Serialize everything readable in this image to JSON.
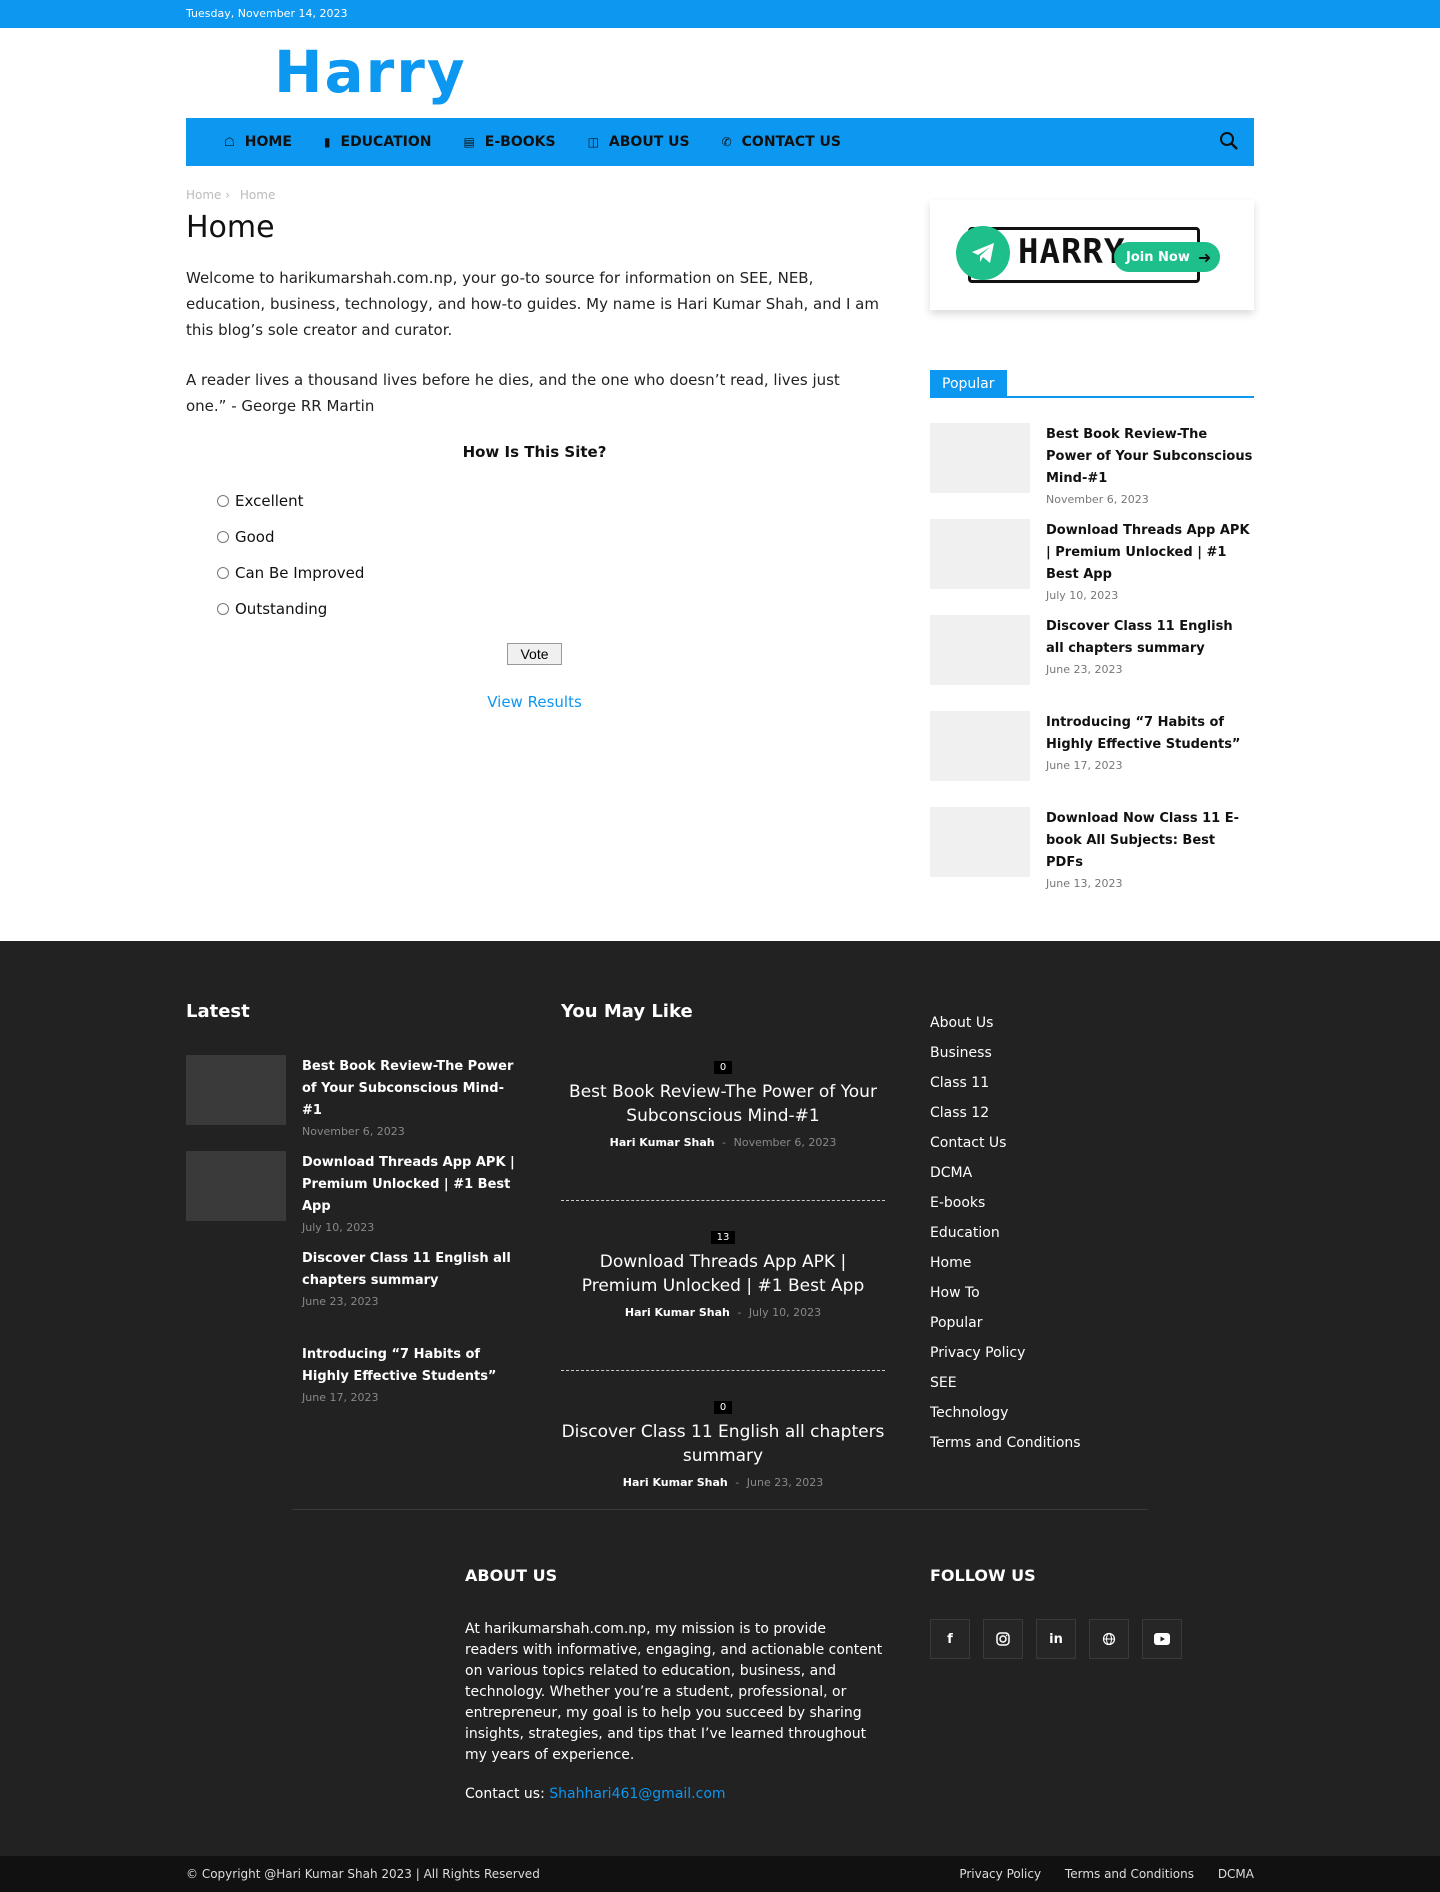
{
  "topbar": {
    "date": "Tuesday, November 14, 2023"
  },
  "header": {
    "logo": "Harry"
  },
  "nav": {
    "items": [
      {
        "label": "HOME",
        "icon": "home-icon"
      },
      {
        "label": "EDUCATION",
        "icon": "book-icon"
      },
      {
        "label": "E-BOOKS",
        "icon": "notebook-icon"
      },
      {
        "label": "ABOUT US",
        "icon": "id-card-icon"
      },
      {
        "label": "CONTACT US",
        "icon": "phone-icon"
      }
    ]
  },
  "breadcrumb": [
    "Home",
    "Home"
  ],
  "page": {
    "title": "Home",
    "intro": "Welcome to harikumarshah.com.np, your go-to source for information on SEE, NEB, education, business, technology, and how-to guides. My name is Hari Kumar Shah, and I am this blog’s sole creator and curator.",
    "quote": "A reader lives a thousand lives before he dies, and the one who doesn’t read, lives just one.” - George RR Martin"
  },
  "poll": {
    "question": "How Is This Site?",
    "options": [
      "Excellent",
      "Good",
      "Can Be Improved",
      "Outstanding"
    ],
    "vote_label": "Vote",
    "results_label": "View Results"
  },
  "promo": {
    "brand": "HARRY",
    "button": "Join Now"
  },
  "popular": {
    "tab": "Popular",
    "items": [
      {
        "title": "Best Book Review-The Power of Your Subconscious Mind-#1",
        "date": "November 6, 2023"
      },
      {
        "title": "Download Threads App APK | Premium Unlocked | #1 Best App",
        "date": "July 10, 2023"
      },
      {
        "title": "Discover Class 11 English all chapters summary",
        "date": "June 23, 2023"
      },
      {
        "title": "Introducing “7 Habits of Highly Effective Students”",
        "date": "June 17, 2023"
      },
      {
        "title": "Download Now Class 11 E-book All Subjects: Best PDFs",
        "date": "June 13, 2023"
      }
    ]
  },
  "footer": {
    "latest": {
      "heading": "Latest",
      "items": [
        {
          "title": "Best Book Review-The Power of Your Subconscious Mind-#1",
          "date": "November 6, 2023"
        },
        {
          "title": "Download Threads App APK | Premium Unlocked | #1 Best App",
          "date": "July 10, 2023"
        },
        {
          "title": "Discover Class 11 English all chapters summary",
          "date": "June 23, 2023"
        },
        {
          "title": "Introducing “7 Habits of Highly Effective Students”",
          "date": "June 17, 2023"
        }
      ]
    },
    "you_may_like": {
      "heading": "You May Like",
      "items": [
        {
          "count": "0",
          "title": "Best Book Review-The Power of Your Subconscious Mind-#1",
          "author": "Hari Kumar Shah",
          "sep": "-",
          "date": "November 6, 2023"
        },
        {
          "count": "13",
          "title": "Download Threads App APK | Premium Unlocked | #1 Best App",
          "author": "Hari Kumar Shah",
          "sep": "-",
          "date": "July 10, 2023"
        },
        {
          "count": "0",
          "title": "Discover Class 11 English all chapters summary",
          "author": "Hari Kumar Shah",
          "sep": "-",
          "date": "June 23, 2023"
        }
      ]
    },
    "categories": [
      "About Us",
      "Business",
      "Class 11",
      "Class 12",
      "Contact Us",
      "DCMA",
      "E-books",
      "Education",
      "Home",
      "How To",
      "Popular",
      "Privacy Policy",
      "SEE",
      "Technology",
      "Terms and Conditions"
    ],
    "about": {
      "heading": "ABOUT US",
      "text": "At harikumarshah.com.np, my mission is to provide readers with informative, engaging, and actionable content on various topics related to education, business, and technology. Whether you’re a student, professional, or entrepreneur, my goal is to help you succeed by sharing insights, strategies, and tips that I’ve learned throughout my years of experience.",
      "contact_label": "Contact us:",
      "email": "Shahhari461@gmail.com"
    },
    "follow": {
      "heading": "FOLLOW US",
      "icons": [
        "facebook-icon",
        "instagram-icon",
        "linkedin-icon",
        "website-icon",
        "youtube-icon"
      ]
    },
    "bottom": {
      "copyright": "© Copyright @Hari Kumar Shah 2023 | All Rights Reserved",
      "links": [
        "Privacy Policy",
        "Terms and Conditions",
        "DCMA"
      ]
    }
  },
  "colors": {
    "accent": "#0c97f1",
    "footer_bg": "#222222",
    "telegram": "#1fbf8b"
  }
}
